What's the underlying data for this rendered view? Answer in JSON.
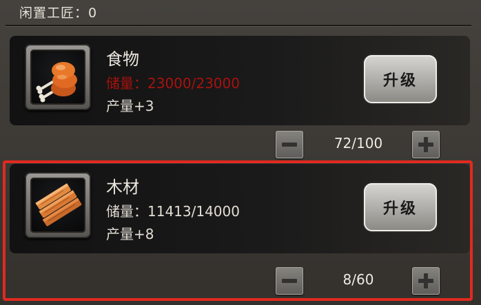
{
  "header": {
    "idle_workers": "闲置工匠：0"
  },
  "resources": [
    {
      "name": "食物",
      "storage": "储量：23000/23000",
      "output": "产量+3",
      "upgrade_label": "升级",
      "assigned": "72/100",
      "storage_full": true,
      "icon": "drumstick-icon"
    },
    {
      "name": "木材",
      "storage": "储量：11413/14000",
      "output": "产量+8",
      "upgrade_label": "升级",
      "assigned": "8/60",
      "storage_full": false,
      "icon": "wood-planks-icon"
    }
  ],
  "colors": {
    "storage_full_text": "#a8120e",
    "highlight_border": "#e12a1f"
  }
}
